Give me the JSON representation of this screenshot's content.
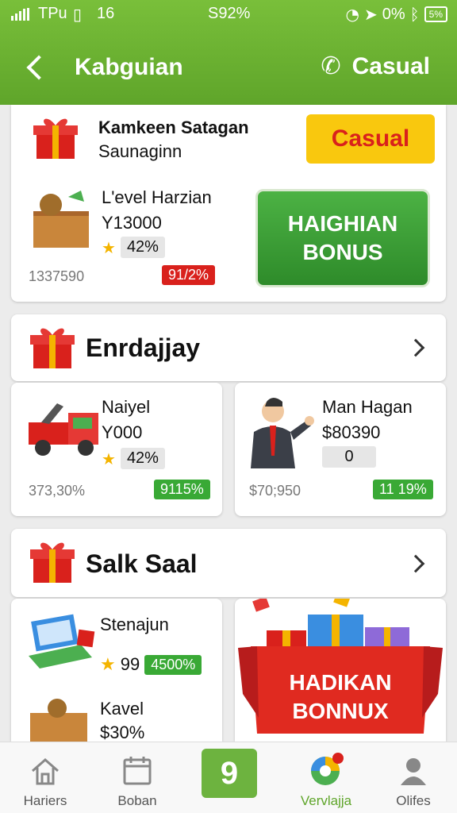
{
  "status_bar": {
    "carrier": "TPu",
    "sim_icon": "sim-icon",
    "time": "16",
    "center": "S92%",
    "right_percent": "0%",
    "battery": "5%"
  },
  "header": {
    "back_icon": "chevron-left-icon",
    "title": "Kabguian",
    "phone_icon": "phone-icon",
    "right_label": "Casual",
    "bg_color": "#6db33f"
  },
  "section1": {
    "title": "Kamkeen Satagan",
    "subtitle": "Saunaginn",
    "badge": "Casual",
    "item": {
      "name": "L'evel Harzian",
      "value": "Y13000",
      "rating": "42%",
      "code": "1337590",
      "discount": "91/2%"
    },
    "bonus_button": "HAIGHIAN BONUS"
  },
  "section2": {
    "title": "Enrdajjay",
    "cards": [
      {
        "name": "Naiyel",
        "value": "Y000",
        "rating": "42%",
        "left": "373,30%",
        "badge": "9115%"
      },
      {
        "name": "Man Hagan",
        "value": "$80390",
        "rating": "0",
        "left": "$70;950",
        "badge": "11 19%"
      }
    ]
  },
  "section3": {
    "title": "Salk Saal",
    "items": [
      {
        "name": "Stenajun",
        "rating": "99",
        "badge": "4500%"
      },
      {
        "name": "Kavel",
        "value": "$30%"
      }
    ],
    "promo": "HADIKAN BONNUX"
  },
  "bottom_nav": {
    "tabs": [
      {
        "label": "Hariers",
        "icon": "home-icon"
      },
      {
        "label": "Boban",
        "icon": "calendar-icon"
      },
      {
        "label": "9",
        "icon": "center-badge"
      },
      {
        "label": "Vervlajja",
        "icon": "wheel-icon"
      },
      {
        "label": "Olifes",
        "icon": "person-icon"
      }
    ],
    "active_color": "#5fa52a"
  }
}
